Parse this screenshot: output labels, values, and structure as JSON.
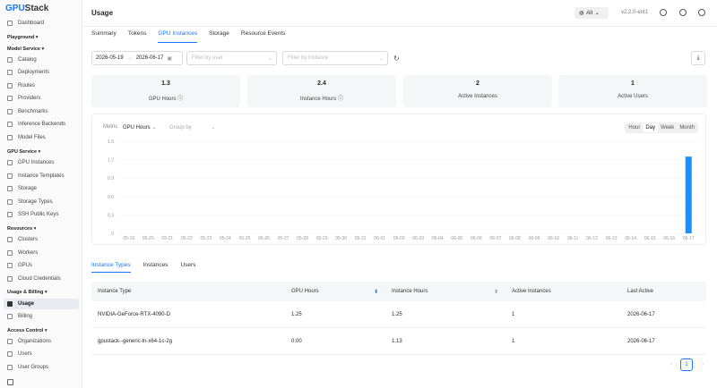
{
  "app": {
    "logo_main": "GPU",
    "logo_rest": "Stack"
  },
  "sidebar": {
    "items": [
      {
        "label": "Dashboard",
        "icon": "dashboard-icon"
      },
      {
        "label": "Playground",
        "section": true
      },
      {
        "label": "Model Service",
        "section": true
      },
      {
        "label": "Catalog",
        "icon": "catalog-icon"
      },
      {
        "label": "Deployments",
        "icon": "deployments-icon"
      },
      {
        "label": "Routes",
        "icon": "routes-icon"
      },
      {
        "label": "Providers",
        "icon": "providers-icon"
      },
      {
        "label": "Benchmarks",
        "icon": "benchmarks-icon"
      },
      {
        "label": "Inference Backends",
        "icon": "backends-icon"
      },
      {
        "label": "Model Files",
        "icon": "files-icon"
      },
      {
        "label": "GPU Service",
        "section": true
      },
      {
        "label": "GPU Instances",
        "icon": "gpu-instances-icon"
      },
      {
        "label": "Instance Templates",
        "icon": "templates-icon"
      },
      {
        "label": "Storage",
        "icon": "storage-icon"
      },
      {
        "label": "Storage Types",
        "icon": "storage-types-icon"
      },
      {
        "label": "SSH Public Keys",
        "icon": "key-icon"
      },
      {
        "label": "Resources",
        "section": true
      },
      {
        "label": "Clusters",
        "icon": "clusters-icon"
      },
      {
        "label": "Workers",
        "icon": "workers-icon"
      },
      {
        "label": "GPUs",
        "icon": "gpus-icon"
      },
      {
        "label": "Cloud Credentials",
        "icon": "cloud-icon"
      },
      {
        "label": "Usage & Billing",
        "section": true
      },
      {
        "label": "Usage",
        "icon": "usage-icon",
        "active": true
      },
      {
        "label": "Billing",
        "icon": "billing-icon"
      },
      {
        "label": "Access Control",
        "section": true
      },
      {
        "label": "Organizations",
        "icon": "organizations-icon"
      },
      {
        "label": "Users",
        "icon": "users-icon"
      },
      {
        "label": "User Groups",
        "icon": "user-groups-icon"
      }
    ]
  },
  "header": {
    "title": "Usage",
    "scope_select": "All",
    "version": "v2.2.0-ent1"
  },
  "tabs": [
    "Summary",
    "Tokens",
    "GPU Instances",
    "Storage",
    "Resource Events"
  ],
  "active_tab": 2,
  "filters": {
    "date_start": "2026-05-19",
    "date_end": "2026-06-17",
    "date_sep": "→",
    "user_placeholder": "Filter by user",
    "instance_placeholder": "Filter by instance"
  },
  "cards": [
    {
      "value": "1.3",
      "label": "GPU Hours",
      "info": true
    },
    {
      "value": "2.4",
      "label": "Instance Hours",
      "info": true
    },
    {
      "value": "2",
      "label": "Active Instances"
    },
    {
      "value": "1",
      "label": "Active Users"
    }
  ],
  "chart_controls": {
    "metric_label": "Metric",
    "metric_value": "GPU Hours",
    "group_by_placeholder": "Group by",
    "granularity": [
      "Hour",
      "Day",
      "Week",
      "Month"
    ],
    "active_granularity": "Day"
  },
  "chart_data": {
    "type": "bar",
    "categories": [
      "05-19",
      "05-20",
      "05-21",
      "05-22",
      "05-23",
      "05-24",
      "05-25",
      "05-26",
      "05-27",
      "05-28",
      "05-29",
      "05-30",
      "05-31",
      "06-01",
      "06-02",
      "06-03",
      "06-04",
      "06-05",
      "06-06",
      "06-07",
      "06-08",
      "06-09",
      "06-10",
      "06-11",
      "06-12",
      "06-13",
      "06-14",
      "06-15",
      "06-16",
      "06-17"
    ],
    "values": [
      0,
      0,
      0,
      0,
      0,
      0,
      0,
      0,
      0,
      0,
      0,
      0,
      0,
      0,
      0,
      0,
      0,
      0,
      0,
      0,
      0,
      0,
      0,
      0,
      0,
      0,
      0,
      0,
      0,
      1.25
    ],
    "yticks": [
      "0",
      "0.3",
      "0.6",
      "0.9",
      "1.2",
      "1.5"
    ],
    "ylim": [
      0,
      1.5
    ],
    "bar_color": "#1890ff",
    "grid": true
  },
  "sub_tabs": [
    "Instance Types",
    "Instances",
    "Users"
  ],
  "table": {
    "columns": [
      "Instance Type",
      "GPU Hours",
      "Instance Hours",
      "Active Instances",
      "Last Active"
    ],
    "rows": [
      [
        "NVIDIA-GeForce-RTX-4090-D",
        "1.25",
        "1.25",
        "1",
        "2026-06-17"
      ],
      [
        "gpustack--generic-ln-x64-1c-2g",
        "0.00",
        "1.13",
        "1",
        "2026-06-17"
      ]
    ]
  },
  "pagination": {
    "current": "1",
    "prev": "‹",
    "next": "›"
  },
  "colors": {
    "accent": "#1677ff"
  }
}
